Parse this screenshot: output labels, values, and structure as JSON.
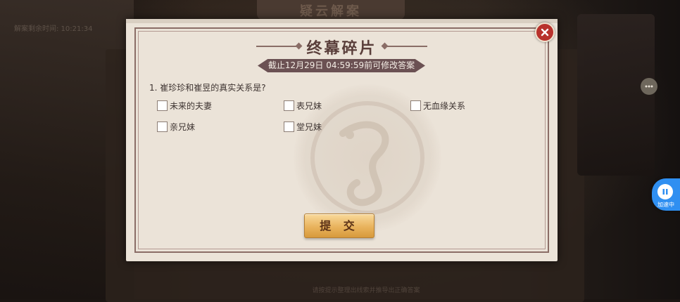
{
  "background": {
    "title": "疑云解案",
    "timer_text": "解案剩余时间: 10:21:34",
    "footer_text": "请按提示整理出线索并推导出正确答案"
  },
  "dialog": {
    "title": "终幕碎片",
    "deadline": "截止12月29日 04:59:59前可修改答案",
    "question": "1. 崔珍珍和崔昱的真实关系是?",
    "options": [
      {
        "label": "未来的夫妻",
        "checked": false
      },
      {
        "label": "表兄妹",
        "checked": false
      },
      {
        "label": "无血缘关系",
        "checked": false
      },
      {
        "label": "亲兄妹",
        "checked": false
      },
      {
        "label": "堂兄妹",
        "checked": false
      }
    ],
    "submit_label": "提 交",
    "close_icon": "close-icon"
  },
  "overlay": {
    "speed_label": "加速中",
    "chat_icon": "chat-bubble-icon",
    "pause_icon": "pause-icon"
  },
  "colors": {
    "dialog_bg": "#ebe3d8",
    "title": "#5a3f3b",
    "deadline_bg": "#6b5153",
    "submit_gold": "#e9b35d",
    "close_red": "#b8322c",
    "speed_blue": "#2f8ff1"
  }
}
